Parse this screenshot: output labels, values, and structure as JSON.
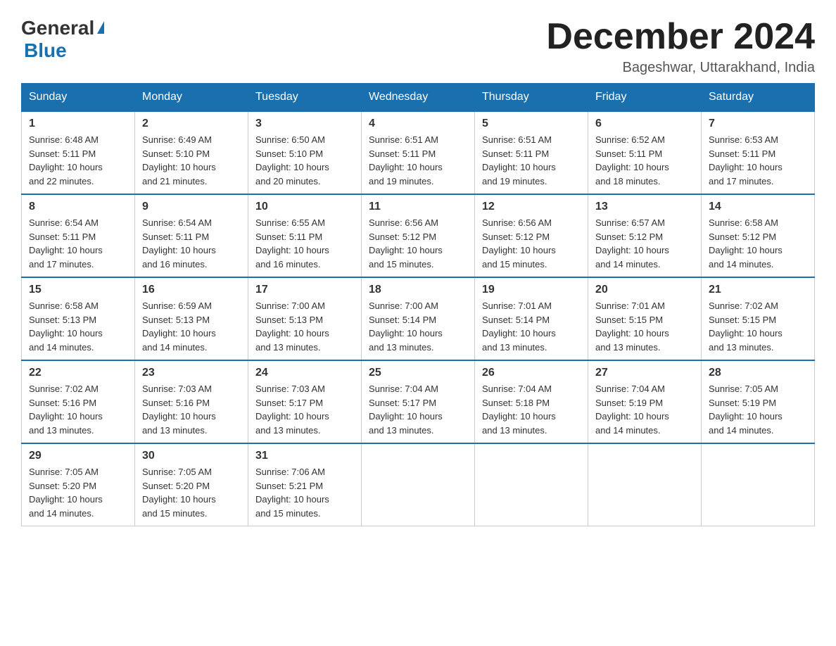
{
  "logo": {
    "general": "General",
    "blue": "Blue",
    "triangle": "▶"
  },
  "title": "December 2024",
  "subtitle": "Bageshwar, Uttarakhand, India",
  "headers": [
    "Sunday",
    "Monday",
    "Tuesday",
    "Wednesday",
    "Thursday",
    "Friday",
    "Saturday"
  ],
  "weeks": [
    [
      {
        "day": "1",
        "info": "Sunrise: 6:48 AM\nSunset: 5:11 PM\nDaylight: 10 hours\nand 22 minutes."
      },
      {
        "day": "2",
        "info": "Sunrise: 6:49 AM\nSunset: 5:10 PM\nDaylight: 10 hours\nand 21 minutes."
      },
      {
        "day": "3",
        "info": "Sunrise: 6:50 AM\nSunset: 5:10 PM\nDaylight: 10 hours\nand 20 minutes."
      },
      {
        "day": "4",
        "info": "Sunrise: 6:51 AM\nSunset: 5:11 PM\nDaylight: 10 hours\nand 19 minutes."
      },
      {
        "day": "5",
        "info": "Sunrise: 6:51 AM\nSunset: 5:11 PM\nDaylight: 10 hours\nand 19 minutes."
      },
      {
        "day": "6",
        "info": "Sunrise: 6:52 AM\nSunset: 5:11 PM\nDaylight: 10 hours\nand 18 minutes."
      },
      {
        "day": "7",
        "info": "Sunrise: 6:53 AM\nSunset: 5:11 PM\nDaylight: 10 hours\nand 17 minutes."
      }
    ],
    [
      {
        "day": "8",
        "info": "Sunrise: 6:54 AM\nSunset: 5:11 PM\nDaylight: 10 hours\nand 17 minutes."
      },
      {
        "day": "9",
        "info": "Sunrise: 6:54 AM\nSunset: 5:11 PM\nDaylight: 10 hours\nand 16 minutes."
      },
      {
        "day": "10",
        "info": "Sunrise: 6:55 AM\nSunset: 5:11 PM\nDaylight: 10 hours\nand 16 minutes."
      },
      {
        "day": "11",
        "info": "Sunrise: 6:56 AM\nSunset: 5:12 PM\nDaylight: 10 hours\nand 15 minutes."
      },
      {
        "day": "12",
        "info": "Sunrise: 6:56 AM\nSunset: 5:12 PM\nDaylight: 10 hours\nand 15 minutes."
      },
      {
        "day": "13",
        "info": "Sunrise: 6:57 AM\nSunset: 5:12 PM\nDaylight: 10 hours\nand 14 minutes."
      },
      {
        "day": "14",
        "info": "Sunrise: 6:58 AM\nSunset: 5:12 PM\nDaylight: 10 hours\nand 14 minutes."
      }
    ],
    [
      {
        "day": "15",
        "info": "Sunrise: 6:58 AM\nSunset: 5:13 PM\nDaylight: 10 hours\nand 14 minutes."
      },
      {
        "day": "16",
        "info": "Sunrise: 6:59 AM\nSunset: 5:13 PM\nDaylight: 10 hours\nand 14 minutes."
      },
      {
        "day": "17",
        "info": "Sunrise: 7:00 AM\nSunset: 5:13 PM\nDaylight: 10 hours\nand 13 minutes."
      },
      {
        "day": "18",
        "info": "Sunrise: 7:00 AM\nSunset: 5:14 PM\nDaylight: 10 hours\nand 13 minutes."
      },
      {
        "day": "19",
        "info": "Sunrise: 7:01 AM\nSunset: 5:14 PM\nDaylight: 10 hours\nand 13 minutes."
      },
      {
        "day": "20",
        "info": "Sunrise: 7:01 AM\nSunset: 5:15 PM\nDaylight: 10 hours\nand 13 minutes."
      },
      {
        "day": "21",
        "info": "Sunrise: 7:02 AM\nSunset: 5:15 PM\nDaylight: 10 hours\nand 13 minutes."
      }
    ],
    [
      {
        "day": "22",
        "info": "Sunrise: 7:02 AM\nSunset: 5:16 PM\nDaylight: 10 hours\nand 13 minutes."
      },
      {
        "day": "23",
        "info": "Sunrise: 7:03 AM\nSunset: 5:16 PM\nDaylight: 10 hours\nand 13 minutes."
      },
      {
        "day": "24",
        "info": "Sunrise: 7:03 AM\nSunset: 5:17 PM\nDaylight: 10 hours\nand 13 minutes."
      },
      {
        "day": "25",
        "info": "Sunrise: 7:04 AM\nSunset: 5:17 PM\nDaylight: 10 hours\nand 13 minutes."
      },
      {
        "day": "26",
        "info": "Sunrise: 7:04 AM\nSunset: 5:18 PM\nDaylight: 10 hours\nand 13 minutes."
      },
      {
        "day": "27",
        "info": "Sunrise: 7:04 AM\nSunset: 5:19 PM\nDaylight: 10 hours\nand 14 minutes."
      },
      {
        "day": "28",
        "info": "Sunrise: 7:05 AM\nSunset: 5:19 PM\nDaylight: 10 hours\nand 14 minutes."
      }
    ],
    [
      {
        "day": "29",
        "info": "Sunrise: 7:05 AM\nSunset: 5:20 PM\nDaylight: 10 hours\nand 14 minutes."
      },
      {
        "day": "30",
        "info": "Sunrise: 7:05 AM\nSunset: 5:20 PM\nDaylight: 10 hours\nand 15 minutes."
      },
      {
        "day": "31",
        "info": "Sunrise: 7:06 AM\nSunset: 5:21 PM\nDaylight: 10 hours\nand 15 minutes."
      },
      {
        "day": "",
        "info": ""
      },
      {
        "day": "",
        "info": ""
      },
      {
        "day": "",
        "info": ""
      },
      {
        "day": "",
        "info": ""
      }
    ]
  ]
}
